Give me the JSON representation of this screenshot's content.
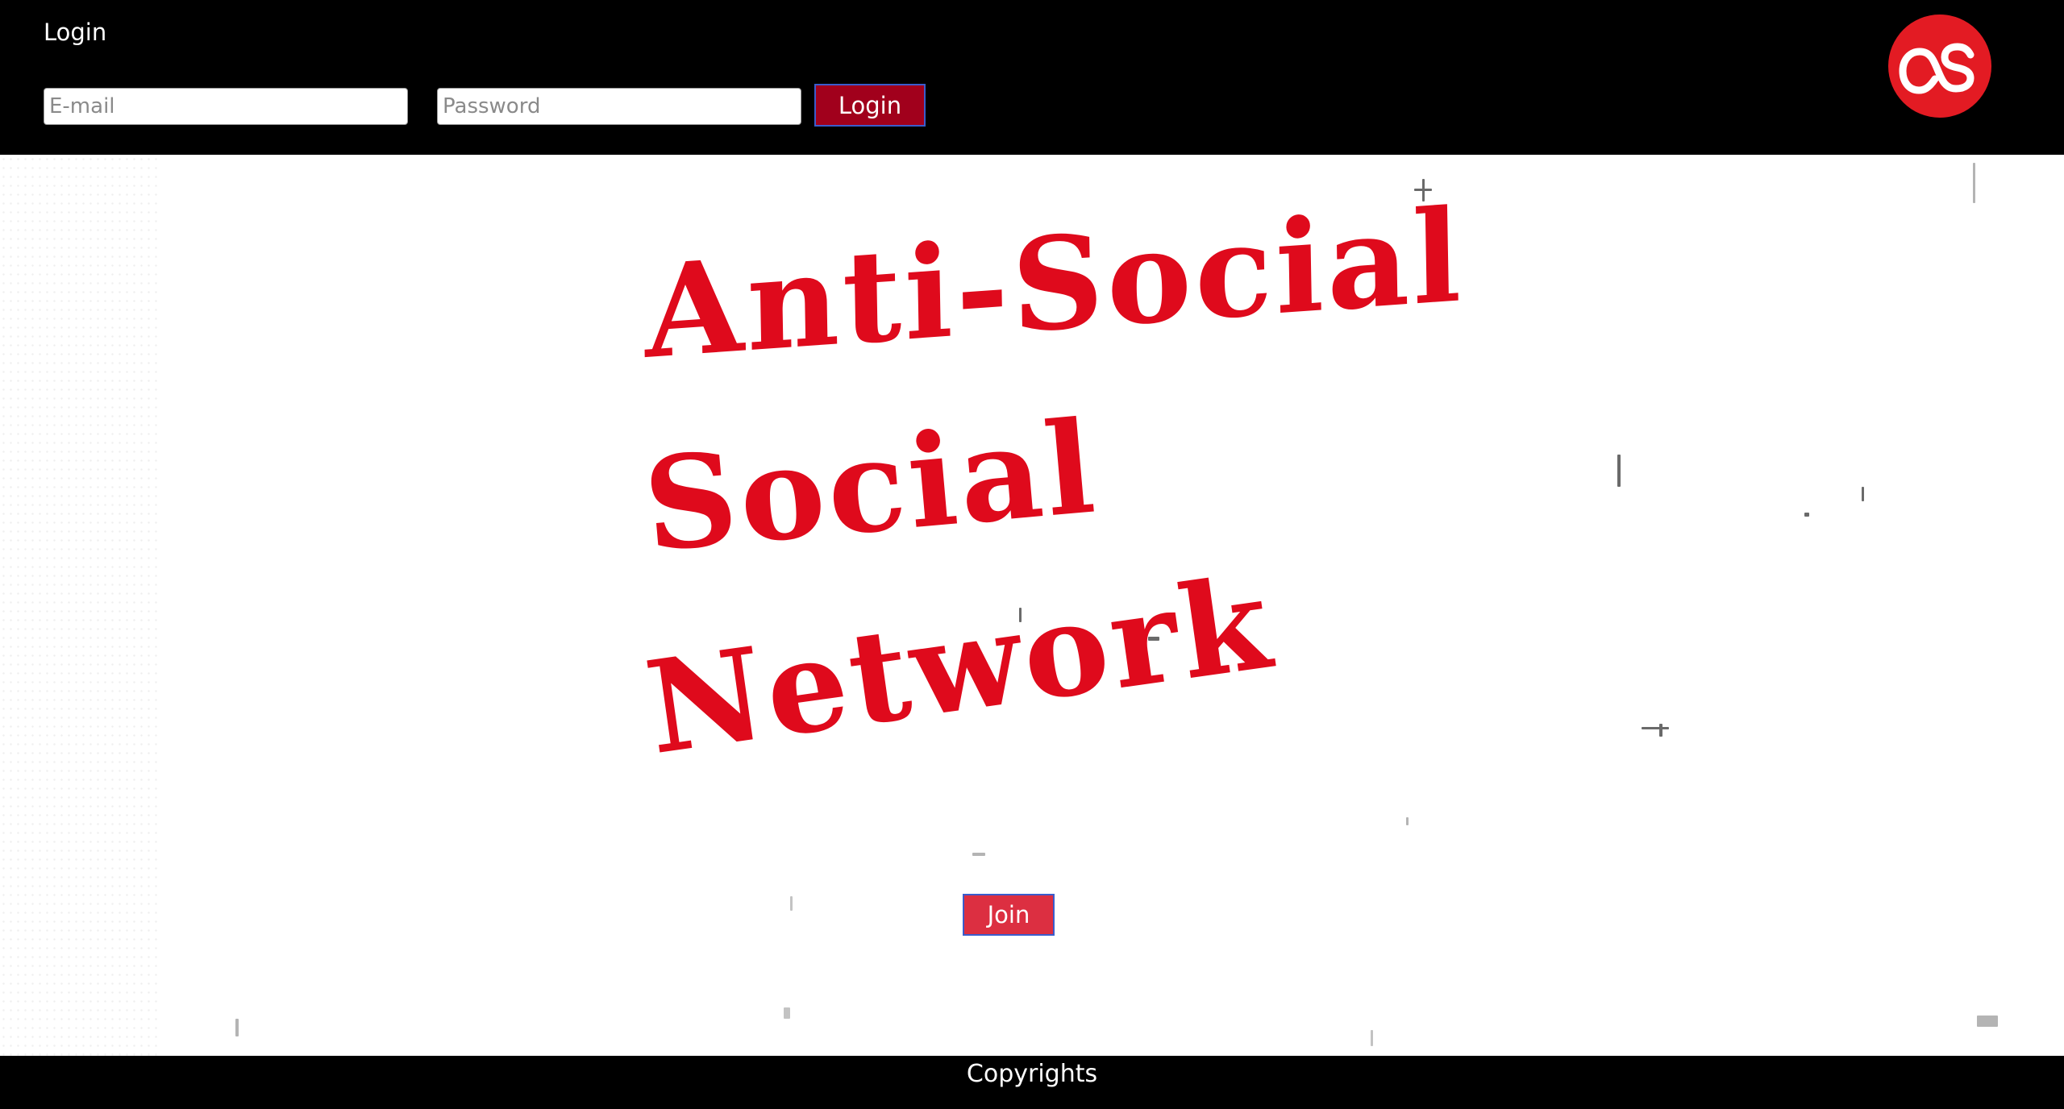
{
  "header": {
    "title": "Login",
    "email_placeholder": "E-mail",
    "password_placeholder": "Password",
    "login_label": "Login"
  },
  "logo": {
    "icon": "lastfm-logo-icon",
    "color": "#e31b23"
  },
  "hero": {
    "lines": [
      "Anti-Social",
      "Social",
      "Network"
    ],
    "color": "#df0a1c"
  },
  "join_label": "Join",
  "footer": {
    "text": "Copyrights"
  },
  "colors": {
    "header_bg": "#000000",
    "login_button": "#a1001c",
    "join_button": "#dc2f41",
    "button_border": "#3b5ccc"
  }
}
